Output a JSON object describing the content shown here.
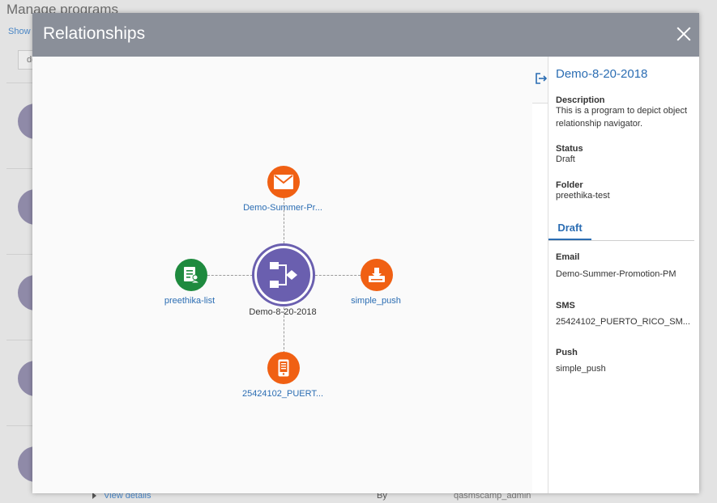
{
  "background": {
    "title": "Manage programs",
    "show_link": "Show",
    "search_value": "de",
    "footer": {
      "view_details": "View details",
      "by_label": "By",
      "user": "qasmscamp_admin"
    }
  },
  "modal": {
    "title": "Relationships",
    "close_icon": "close-icon"
  },
  "graph": {
    "center": {
      "label": "Demo-8-20-2018",
      "icon": "program-flow-icon",
      "color": "#6a5faf"
    },
    "top": {
      "label": "Demo-Summer-Pr...",
      "icon": "email-icon",
      "color": "#f06013"
    },
    "left": {
      "label": "preethika-list",
      "icon": "list-contact-icon",
      "color": "#1e8a3e"
    },
    "right": {
      "label": "simple_push",
      "icon": "push-download-icon",
      "color": "#f06013"
    },
    "bottom": {
      "label": "25424102_PUERT...",
      "icon": "mobile-sms-icon",
      "color": "#f06013"
    }
  },
  "side_panel": {
    "exit_icon": "exit-panel-icon",
    "title": "Demo-8-20-2018",
    "description_label": "Description",
    "description_value": "This is a program to depict object relationship navigator.",
    "status_label": "Status",
    "status_value": "Draft",
    "folder_label": "Folder",
    "folder_value": "preethika-test",
    "tab_label": "Draft",
    "email_label": "Email",
    "email_value": "Demo-Summer-Promotion-PM",
    "sms_label": "SMS",
    "sms_value": "25424102_PUERTO_RICO_SM...",
    "push_label": "Push",
    "push_value": "simple_push"
  }
}
